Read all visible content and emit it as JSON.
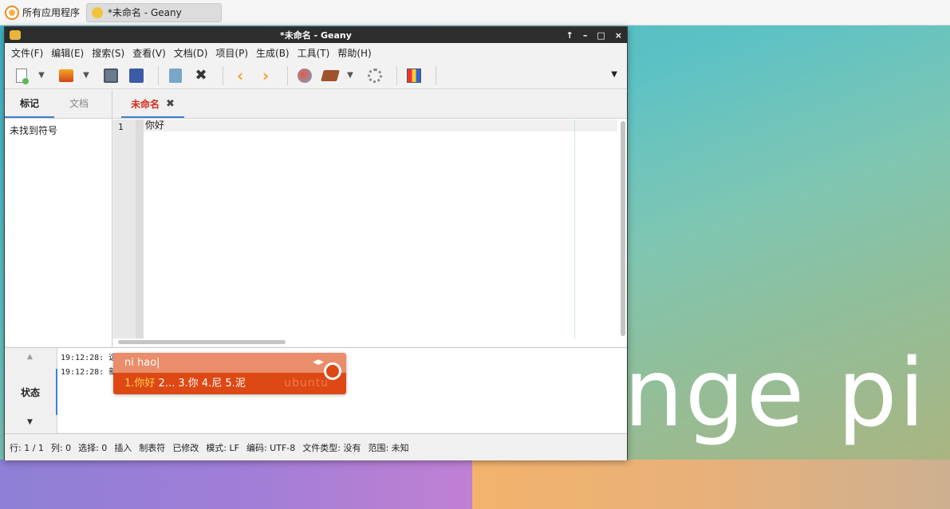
{
  "taskbar": {
    "menu_label": "所有应用程序",
    "task_title": "*未命名 - Geany"
  },
  "window": {
    "title": "*未命名 - Geany",
    "controls": [
      "↑",
      "–",
      "□",
      "×"
    ]
  },
  "menubar": {
    "items": [
      "文件(F)",
      "编辑(E)",
      "搜索(S)",
      "查看(V)",
      "文档(D)",
      "项目(P)",
      "生成(B)",
      "工具(T)",
      "帮助(H)"
    ]
  },
  "sidebar": {
    "tabs": [
      "标记",
      "文档"
    ],
    "message": "未找到符号"
  },
  "editor": {
    "tab_label": "未命名",
    "line_number": "1",
    "line_text": "你好"
  },
  "messages": {
    "tab_label": "状态",
    "lines": [
      "19:12:28: 这",
      "19:12:28: 新"
    ]
  },
  "statusbar": {
    "row": "行: 1 / 1",
    "col": "列: 0",
    "sel": "选择: 0",
    "mode": "插入",
    "tab": "制表符",
    "modified": "已修改",
    "eol": "模式: LF",
    "encoding": "编码: UTF-8",
    "filetype": "文件类型: 没有",
    "scope": "范围: 未知"
  },
  "ime": {
    "input": "ni hao|",
    "candidate1": "1.你好",
    "candidates_rest": " 2... 3.你 4.尼 5.泥",
    "brand": "ubuntu"
  },
  "desktop": {
    "brand_text": "nge pi"
  }
}
